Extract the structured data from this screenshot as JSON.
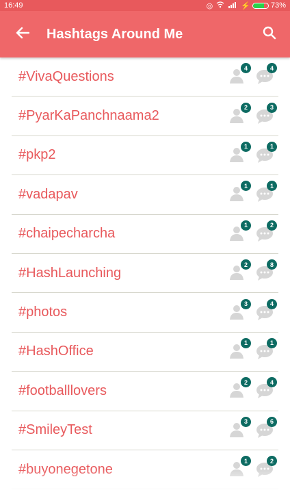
{
  "status": {
    "time": "16:49",
    "battery": "73%",
    "battery_level": 0.73
  },
  "appbar": {
    "title": "Hashtags Around Me",
    "back_icon": "arrow-left-icon",
    "search_icon": "search-icon"
  },
  "colors": {
    "accent": "#ef6769",
    "tag_text": "#e8595c",
    "badge": "#0d6b62"
  },
  "items": [
    {
      "tag": "#VivaQuestions",
      "users": "4",
      "posts": "4"
    },
    {
      "tag": "#PyarKaPanchnaama2",
      "users": "2",
      "posts": "3"
    },
    {
      "tag": "#pkp2",
      "users": "1",
      "posts": "1"
    },
    {
      "tag": "#vadapav",
      "users": "1",
      "posts": "1"
    },
    {
      "tag": "#chaipecharcha",
      "users": "1",
      "posts": "2"
    },
    {
      "tag": "#HashLaunching",
      "users": "2",
      "posts": "8"
    },
    {
      "tag": "#photos",
      "users": "3",
      "posts": "4"
    },
    {
      "tag": "#HashOffice",
      "users": "1",
      "posts": "1"
    },
    {
      "tag": "#footballlovers",
      "users": "2",
      "posts": "4"
    },
    {
      "tag": "#SmileyTest",
      "users": "3",
      "posts": "6"
    },
    {
      "tag": "#buyonegetone",
      "users": "1",
      "posts": "2"
    }
  ]
}
